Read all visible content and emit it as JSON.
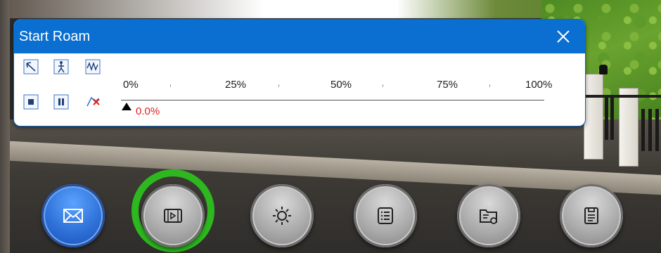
{
  "dialog": {
    "title": "Start Roam",
    "close_icon": "close-icon"
  },
  "toolbar": {
    "tools": [
      {
        "name": "roam-path-icon"
      },
      {
        "name": "walk-mode-icon"
      },
      {
        "name": "wave-path-icon"
      },
      {
        "name": "stop-icon"
      },
      {
        "name": "pause-icon"
      },
      {
        "name": "clear-path-icon"
      }
    ]
  },
  "progress": {
    "labels": [
      "0%",
      "25%",
      "50%",
      "75%",
      "100%"
    ],
    "current_value": "0.0%",
    "current_fraction": 0.0
  },
  "bottom_bar": {
    "buttons": [
      {
        "name": "mail-button",
        "icon": "envelope-icon",
        "active": true
      },
      {
        "name": "video-button",
        "icon": "film-play-icon",
        "highlighted": true
      },
      {
        "name": "lighting-button",
        "icon": "sun-icon"
      },
      {
        "name": "list-button",
        "icon": "list-icon"
      },
      {
        "name": "folder-settings-button",
        "icon": "folder-settings-icon"
      },
      {
        "name": "report-button",
        "icon": "document-icon"
      }
    ]
  },
  "colors": {
    "titlebar": "#0a6fd0",
    "progress_text": "#e0201a",
    "highlight_ring": "#2db81f",
    "active_button": "#2d6fd6"
  }
}
